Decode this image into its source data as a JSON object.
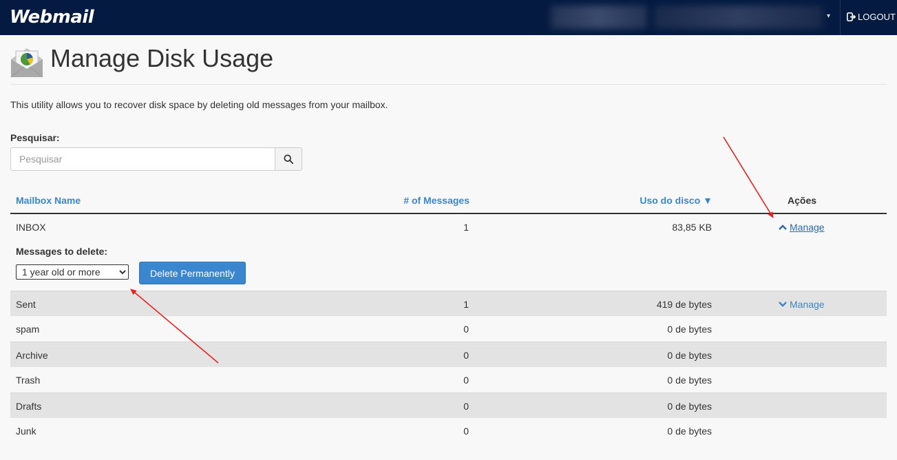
{
  "header": {
    "brand": "Webmail",
    "logout_label": "LOGOUT"
  },
  "page": {
    "title": "Manage Disk Usage",
    "description": "This utility allows you to recover disk space by deleting old messages from your mailbox."
  },
  "search": {
    "label": "Pesquisar:",
    "placeholder": "Pesquisar"
  },
  "table": {
    "headers": {
      "name": "Mailbox Name",
      "count": "# of Messages",
      "size": "Uso do disco ▼",
      "actions": "Ações"
    },
    "rows": [
      {
        "name": "INBOX",
        "count": "1",
        "size": "83,85 KB",
        "action": "Manage"
      },
      {
        "name": "Sent",
        "count": "1",
        "size": "419 de bytes",
        "action": "Manage"
      },
      {
        "name": "spam",
        "count": "0",
        "size": "0 de bytes"
      },
      {
        "name": "Archive",
        "count": "0",
        "size": "0 de bytes"
      },
      {
        "name": "Trash",
        "count": "0",
        "size": "0 de bytes"
      },
      {
        "name": "Drafts",
        "count": "0",
        "size": "0 de bytes"
      },
      {
        "name": "Junk",
        "count": "0",
        "size": "0 de bytes"
      }
    ]
  },
  "expand": {
    "label": "Messages to delete:",
    "selected_option": "1 year old or more",
    "delete_label": "Delete Permanently"
  },
  "colors": {
    "header_bg": "#041a40",
    "link": "#3a87c8",
    "button": "#3a87d0",
    "stripe": "#e3e3e3",
    "annotation_arrow": "#e8201c"
  }
}
